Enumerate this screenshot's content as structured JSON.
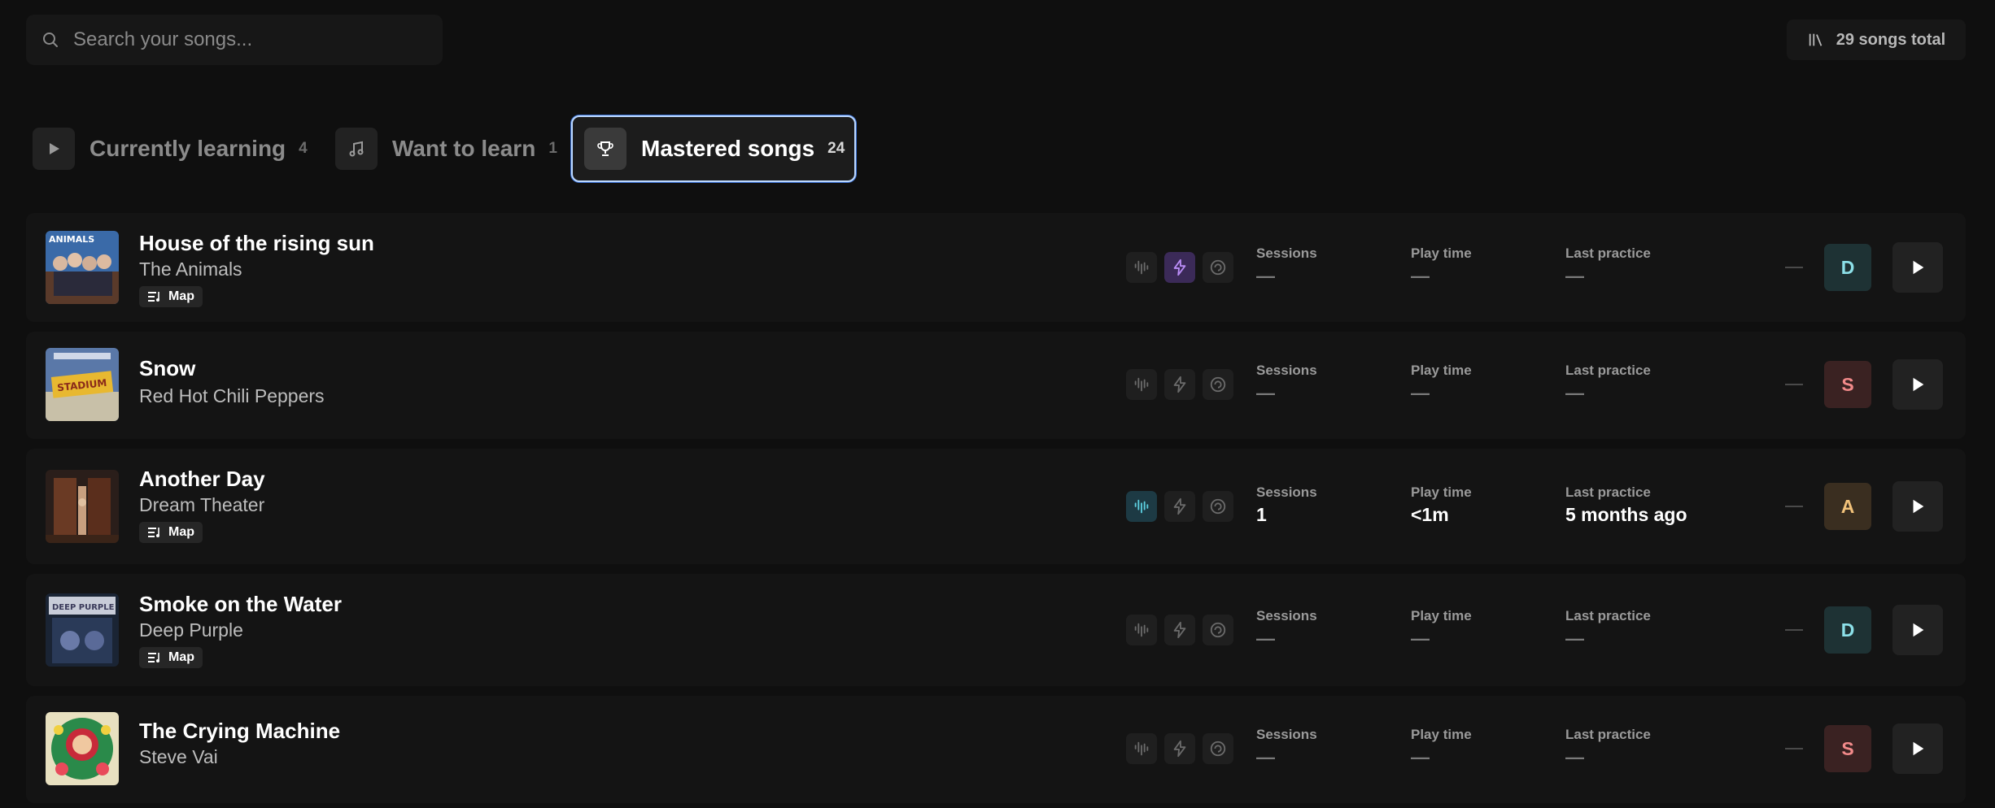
{
  "search": {
    "placeholder": "Search your songs..."
  },
  "total": {
    "label": "29 songs total"
  },
  "tabs": [
    {
      "label": "Currently learning",
      "count": "4",
      "icon": "play-icon",
      "active": false
    },
    {
      "label": "Want to learn",
      "count": "1",
      "icon": "music-note-icon",
      "active": false
    },
    {
      "label": "Mastered songs",
      "count": "24",
      "icon": "trophy-icon",
      "active": true
    }
  ],
  "stat_labels": {
    "sessions": "Sessions",
    "play_time": "Play time",
    "last_practice": "Last practice"
  },
  "map_label": "Map",
  "songs": [
    {
      "title": "House of the rising sun",
      "artist": "The Animals",
      "map": true,
      "modes": [
        "off",
        "purple",
        "off"
      ],
      "sessions": "—",
      "play_time": "—",
      "last_practice": "—",
      "grade": "D",
      "grade_color": "#8ce0e8",
      "grade_bg": "#1e3234"
    },
    {
      "title": "Snow",
      "artist": "Red Hot Chili Peppers",
      "map": false,
      "modes": [
        "off",
        "off",
        "off"
      ],
      "sessions": "—",
      "play_time": "—",
      "last_practice": "—",
      "grade": "S",
      "grade_color": "#f28a8a",
      "grade_bg": "#3a2222"
    },
    {
      "title": "Another Day",
      "artist": "Dream Theater",
      "map": true,
      "modes": [
        "cyan",
        "off",
        "off"
      ],
      "sessions": "1",
      "play_time": "<1m",
      "last_practice": "5 months ago",
      "grade": "A",
      "grade_color": "#f2c27a",
      "grade_bg": "#3a2e20"
    },
    {
      "title": "Smoke on the Water",
      "artist": "Deep Purple",
      "map": true,
      "modes": [
        "off",
        "off",
        "off"
      ],
      "sessions": "—",
      "play_time": "—",
      "last_practice": "—",
      "grade": "D",
      "grade_color": "#8ce0e8",
      "grade_bg": "#1e3234"
    },
    {
      "title": "The Crying Machine",
      "artist": "Steve Vai",
      "map": false,
      "modes": [
        "off",
        "off",
        "off"
      ],
      "sessions": "—",
      "play_time": "—",
      "last_practice": "—",
      "grade": "S",
      "grade_color": "#f28a8a",
      "grade_bg": "#3a2222"
    }
  ]
}
